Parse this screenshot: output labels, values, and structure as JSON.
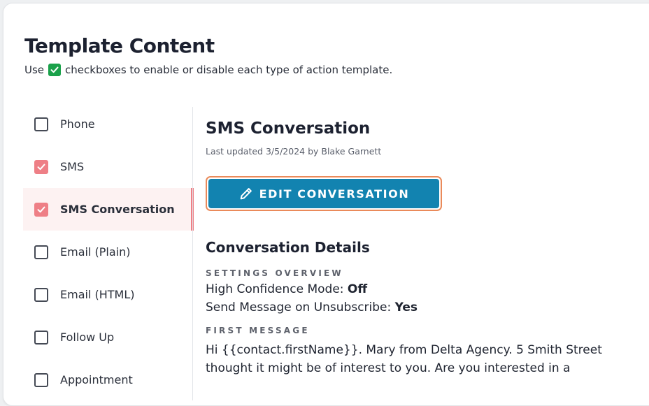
{
  "header": {
    "title": "Template Content",
    "subtitle_before": "Use",
    "subtitle_after": "checkboxes to enable or disable each type of action template."
  },
  "sidebar": {
    "items": [
      {
        "label": "Phone",
        "checked": false,
        "active": false
      },
      {
        "label": "SMS",
        "checked": true,
        "active": false
      },
      {
        "label": "SMS Conversation",
        "checked": true,
        "active": true
      },
      {
        "label": "Email (Plain)",
        "checked": false,
        "active": false
      },
      {
        "label": "Email (HTML)",
        "checked": false,
        "active": false
      },
      {
        "label": "Follow Up",
        "checked": false,
        "active": false
      },
      {
        "label": "Appointment",
        "checked": false,
        "active": false
      }
    ]
  },
  "main": {
    "title": "SMS Conversation",
    "updated": "Last updated 3/5/2024 by Blake Garnett",
    "edit_button": "EDIT CONVERSATION",
    "details_title": "Conversation Details",
    "settings_overline": "SETTINGS OVERVIEW",
    "high_confidence_label": "High Confidence Mode:",
    "high_confidence_value": "Off",
    "send_unsub_label": "Send Message on Unsubscribe:",
    "send_unsub_value": "Yes",
    "first_message_overline": "FIRST MESSAGE",
    "first_message_line1": "Hi {{contact.firstName}}. Mary from Delta Agency. 5 Smith Street",
    "first_message_line2": "thought it might be of interest to you. Are you interested in a"
  },
  "colors": {
    "accent": "#1283b0",
    "checked": "#ee7f86",
    "active_bg": "#fdf2f2",
    "focus_ring": "#ea8a5a",
    "green_check": "#1aa14a"
  },
  "icons": {
    "subtitle_check": "check-square-icon",
    "edit": "pencil-icon"
  }
}
